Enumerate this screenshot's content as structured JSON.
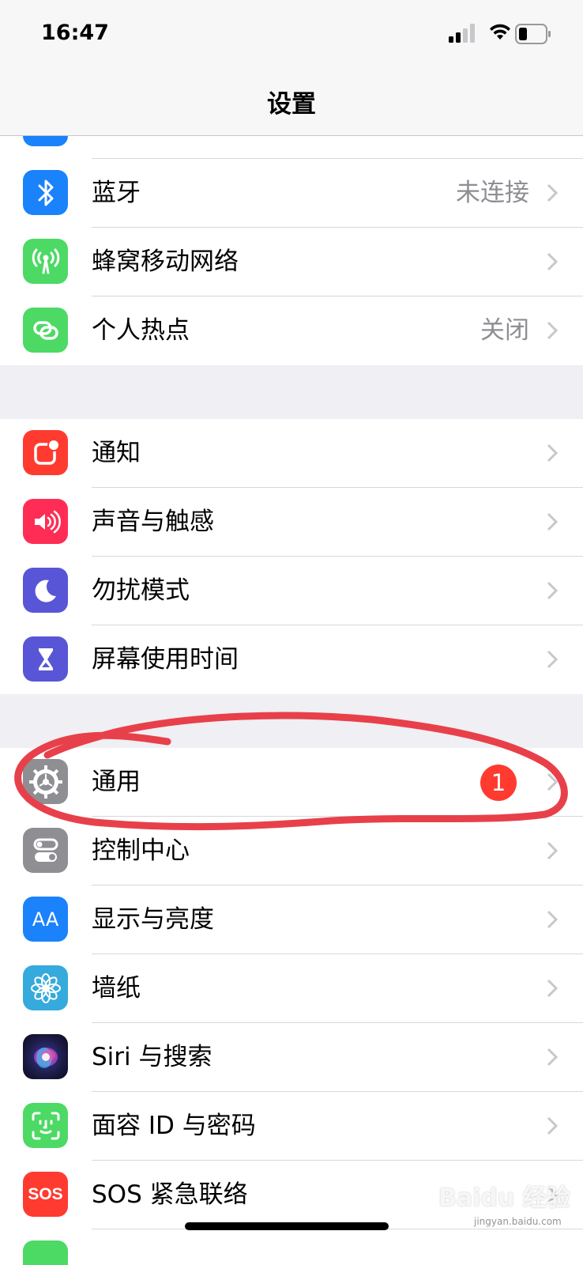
{
  "status": {
    "time": "16:47"
  },
  "nav": {
    "title": "设置"
  },
  "colors": {
    "blue": "#1a82fb",
    "green": "#4cd964",
    "red": "#ff3b30",
    "pink": "#ff2d55",
    "purple": "#5856d6",
    "gray": "#8e8e93",
    "teal": "#35aadc",
    "annotation": "#e8404a"
  },
  "groups": [
    {
      "items": [
        {
          "label": "蓝牙",
          "value": "未连接",
          "icon": "bluetooth-icon"
        },
        {
          "label": "蜂窝移动网络",
          "value": "",
          "icon": "cellular-antenna-icon"
        },
        {
          "label": "个人热点",
          "value": "关闭",
          "icon": "hotspot-chain-icon"
        }
      ]
    },
    {
      "items": [
        {
          "label": "通知",
          "value": "",
          "icon": "notifications-icon"
        },
        {
          "label": "声音与触感",
          "value": "",
          "icon": "speaker-icon"
        },
        {
          "label": "勿扰模式",
          "value": "",
          "icon": "moon-icon"
        },
        {
          "label": "屏幕使用时间",
          "value": "",
          "icon": "hourglass-icon"
        }
      ]
    },
    {
      "items": [
        {
          "label": "通用",
          "value": "",
          "badge": "1",
          "icon": "gear-icon"
        },
        {
          "label": "控制中心",
          "value": "",
          "icon": "toggles-icon"
        },
        {
          "label": "显示与亮度",
          "value": "",
          "icon": "text-size-icon",
          "icon_text": "AA"
        },
        {
          "label": "墙纸",
          "value": "",
          "icon": "flower-icon"
        },
        {
          "label": "Siri 与搜索",
          "value": "",
          "icon": "siri-icon"
        },
        {
          "label": "面容 ID 与密码",
          "value": "",
          "icon": "face-id-icon"
        },
        {
          "label": "SOS 紧急联络",
          "value": "",
          "icon": "sos-icon",
          "icon_text": "SOS"
        }
      ]
    }
  ],
  "watermark": {
    "text": "Baidu 经验",
    "sub": "jingyan.baidu.com"
  }
}
